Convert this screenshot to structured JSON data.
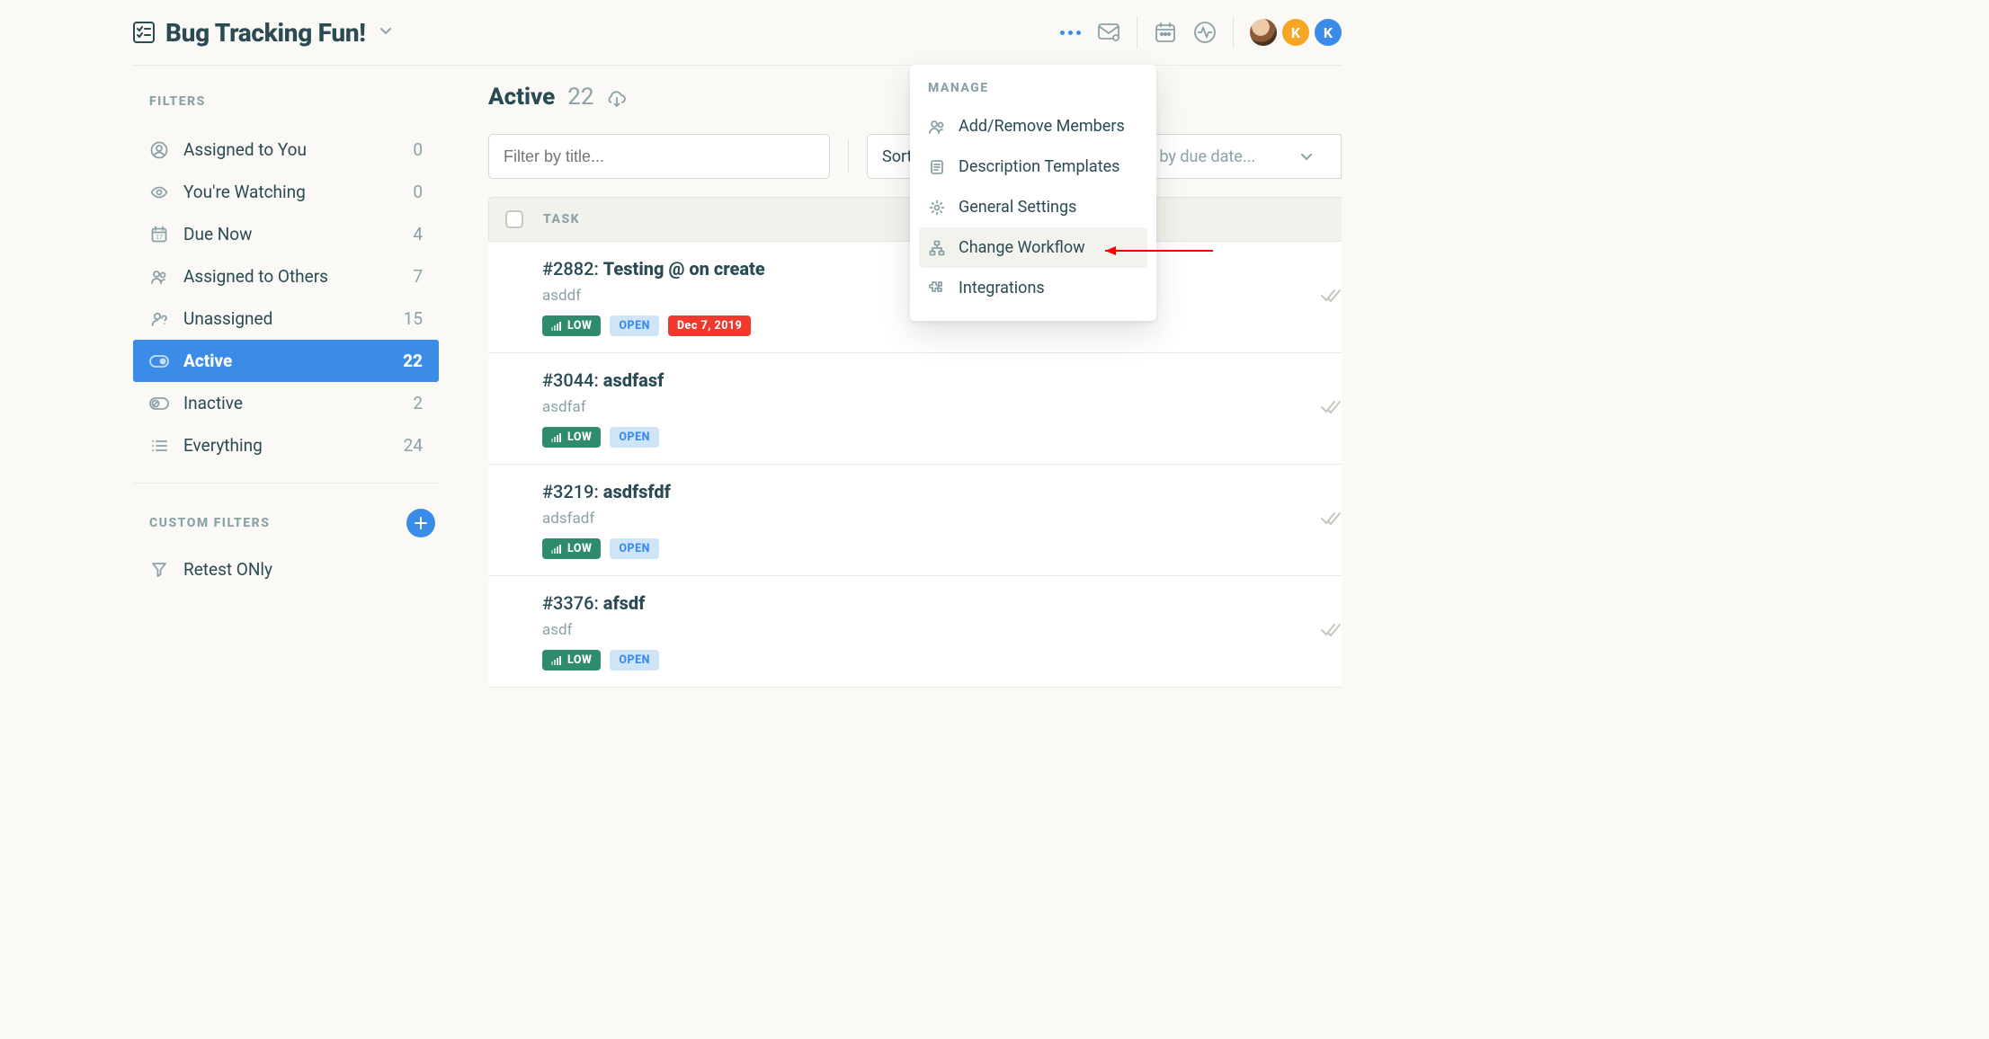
{
  "header": {
    "title": "Bug Tracking Fun!",
    "avatars": [
      {
        "type": "img",
        "bg": "",
        "label": ""
      },
      {
        "type": "letter",
        "bg": "#F5A623",
        "label": "K"
      },
      {
        "type": "letter",
        "bg": "#3A8CE8",
        "label": "K"
      }
    ]
  },
  "sidebar": {
    "filtersLabel": "FILTERS",
    "filters": [
      {
        "icon": "user-circle",
        "label": "Assigned to You",
        "count": "0",
        "active": false
      },
      {
        "icon": "eye",
        "label": "You're Watching",
        "count": "0",
        "active": false
      },
      {
        "icon": "calendar17",
        "label": "Due Now",
        "count": "4",
        "active": false
      },
      {
        "icon": "users",
        "label": "Assigned to Others",
        "count": "7",
        "active": false
      },
      {
        "icon": "user-q",
        "label": "Unassigned",
        "count": "15",
        "active": false
      },
      {
        "icon": "toggle-on",
        "label": "Active",
        "count": "22",
        "active": true
      },
      {
        "icon": "toggle-off",
        "label": "Inactive",
        "count": "2",
        "active": false
      },
      {
        "icon": "list",
        "label": "Everything",
        "count": "24",
        "active": false
      }
    ],
    "customLabel": "CUSTOM FILTERS",
    "customFilters": [
      {
        "icon": "funnel",
        "label": "Retest ONly"
      }
    ]
  },
  "main": {
    "title": "Active",
    "count": "22",
    "filterPlaceholder": "Filter by title...",
    "sortLabel": "Sort",
    "dueFilterLabel": "lter by due date...",
    "taskColLabel": "TASK",
    "badgeLow": "LOW",
    "badgeOpen": "OPEN"
  },
  "tasks": [
    {
      "num": "#2882",
      "title": "Testing @ on create",
      "sub": "asddf",
      "low": true,
      "open": true,
      "due": "Dec 7, 2019"
    },
    {
      "num": "#3044",
      "title": "asdfasf",
      "sub": "asdfaf",
      "low": true,
      "open": true,
      "due": ""
    },
    {
      "num": "#3219",
      "title": "asdfsfdf",
      "sub": "adsfadf",
      "low": true,
      "open": true,
      "due": ""
    },
    {
      "num": "#3376",
      "title": "afsdf",
      "sub": "asdf",
      "low": true,
      "open": true,
      "due": ""
    }
  ],
  "menu": {
    "label": "MANAGE",
    "items": [
      {
        "icon": "users",
        "label": "Add/Remove Members",
        "highlight": false
      },
      {
        "icon": "doc",
        "label": "Description Templates",
        "highlight": false
      },
      {
        "icon": "gear",
        "label": "General Settings",
        "highlight": false
      },
      {
        "icon": "workflow",
        "label": "Change Workflow",
        "highlight": true
      },
      {
        "icon": "puzzle",
        "label": "Integrations",
        "highlight": false
      }
    ]
  },
  "colors": {
    "accent": "#3A8CE8",
    "green": "#2E8B6D",
    "red": "#F0382E",
    "text": "#2A4A54",
    "muted": "#8BA1A8"
  }
}
